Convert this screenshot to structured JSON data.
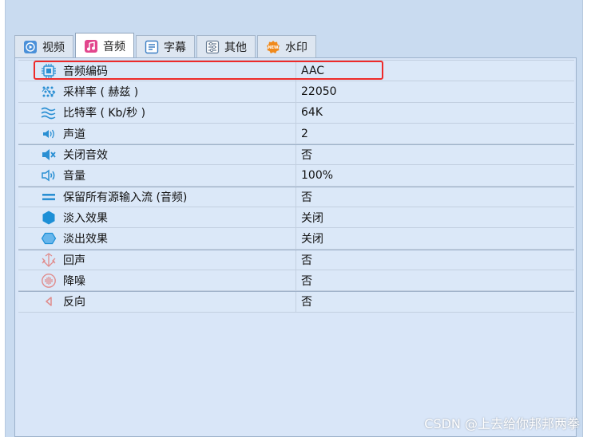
{
  "tabs": [
    {
      "label": "视频",
      "icon": "video-icon"
    },
    {
      "label": "音频",
      "icon": "music-icon",
      "active": true
    },
    {
      "label": "字幕",
      "icon": "subtitle-icon"
    },
    {
      "label": "其他",
      "icon": "sliders-icon"
    },
    {
      "label": "水印",
      "icon": "watermark-icon"
    }
  ],
  "rows": [
    {
      "name": "音频编码",
      "value": "AAC",
      "icon": "chip-icon"
    },
    {
      "name": "采样率 ( 赫兹 )",
      "value": "22050",
      "icon": "sampling-icon"
    },
    {
      "name": "比特率 ( Kb/秒 )",
      "value": "64K",
      "icon": "wave-icon"
    },
    {
      "name": "声道",
      "value": "2",
      "icon": "channel-icon"
    },
    {
      "name": "关闭音效",
      "value": "否",
      "icon": "mute-icon"
    },
    {
      "name": "音量",
      "value": "100%",
      "icon": "volume-icon"
    },
    {
      "name": "保留所有源输入流 (音频)",
      "value": "否",
      "icon": "equals-icon"
    },
    {
      "name": "淡入效果",
      "value": "关闭",
      "icon": "fade-in-icon"
    },
    {
      "name": "淡出效果",
      "value": "关闭",
      "icon": "fade-out-icon"
    },
    {
      "name": "回声",
      "value": "否",
      "icon": "echo-icon"
    },
    {
      "name": "降噪",
      "value": "否",
      "icon": "denoise-icon"
    },
    {
      "name": "反向",
      "value": "否",
      "icon": "reverse-icon"
    }
  ],
  "watermark": "CSDN @上去给你邦邦两拳",
  "colors": {
    "accent": "#1d8fd6",
    "highlight": "#ee2a2a",
    "panel": "#dbe8f8"
  }
}
